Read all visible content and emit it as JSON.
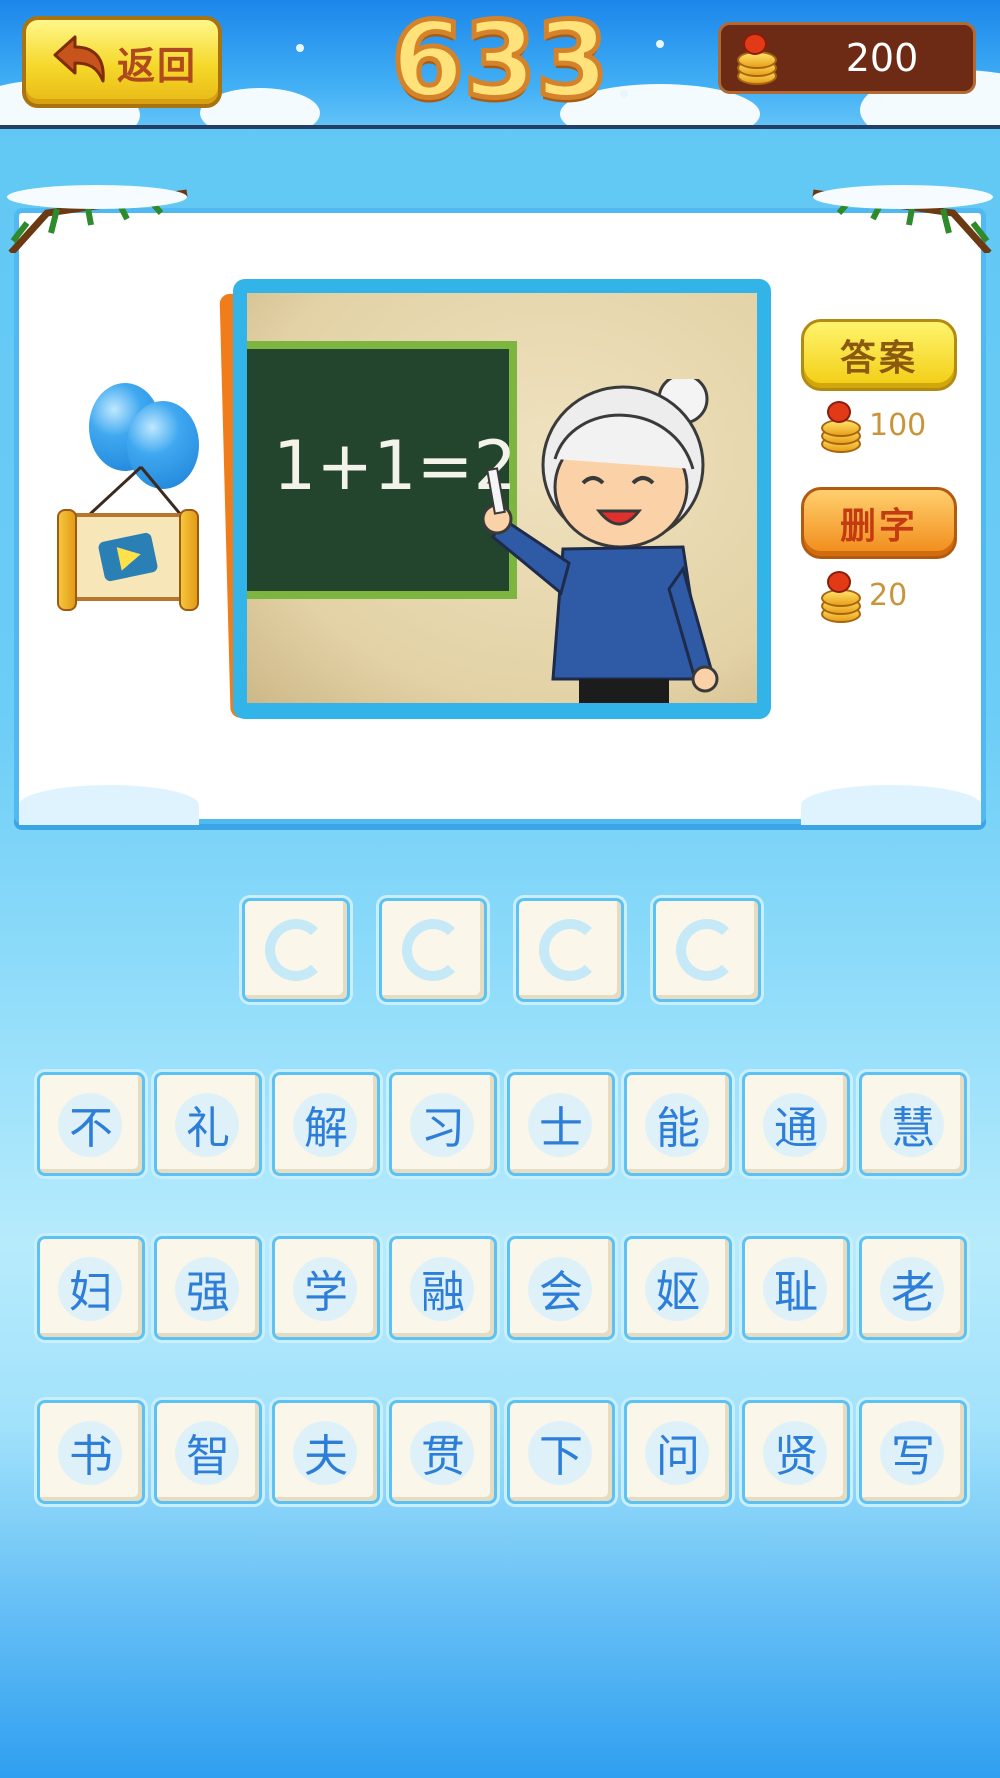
{
  "header": {
    "back_label": "返回",
    "level": "633",
    "coins": "200"
  },
  "hints": {
    "answer_label": "答案",
    "answer_cost": "100",
    "delete_label": "删字",
    "delete_cost": "20"
  },
  "picture": {
    "blackboard_text": "1+1=2"
  },
  "answer_slots": [
    "",
    "",
    "",
    ""
  ],
  "candidates": [
    [
      "不",
      "礼",
      "解",
      "习",
      "士",
      "能",
      "通",
      "慧"
    ],
    [
      "妇",
      "强",
      "学",
      "融",
      "会",
      "妪",
      "耻",
      "老"
    ],
    [
      "书",
      "智",
      "夫",
      "贯",
      "下",
      "问",
      "贤",
      "写"
    ]
  ],
  "colors": {
    "accent_blue": "#2d7ed9",
    "header_blue": "#1c86ea",
    "button_yellow": "#f2cd12",
    "button_orange": "#f08a18"
  }
}
